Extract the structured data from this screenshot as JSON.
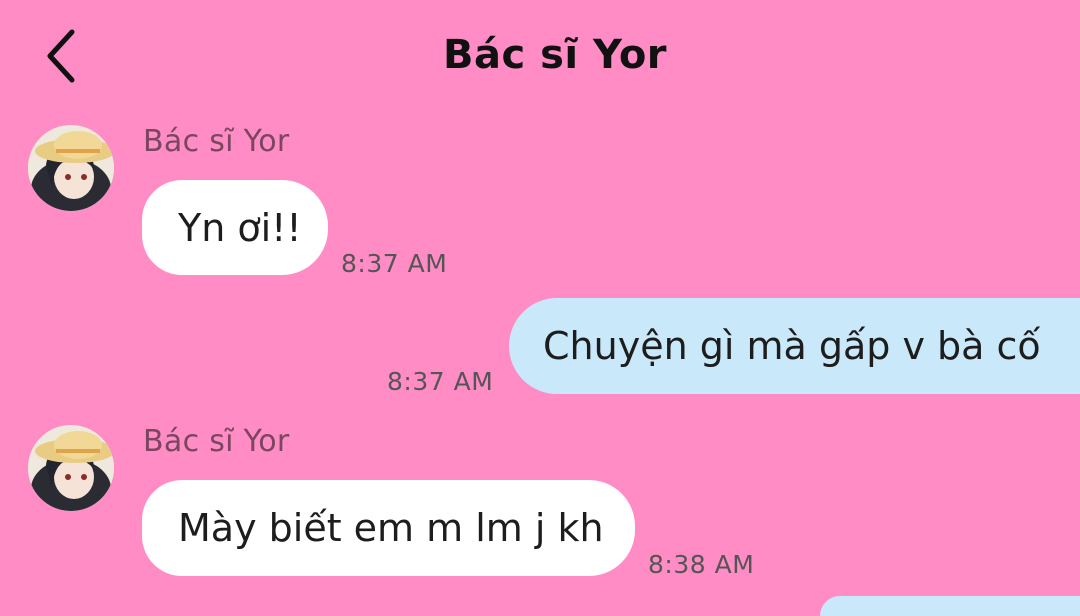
{
  "header": {
    "title": "Bác sĩ Yor",
    "back_icon": "chevron-left-icon"
  },
  "colors": {
    "background": "#ff8cc5",
    "incoming_bubble": "#ffffff",
    "outgoing_bubble": "#c9e9fb"
  },
  "messages": [
    {
      "direction": "incoming",
      "sender": "Bác sĩ Yor",
      "text": "Yn ơi!!",
      "time": "8:37 AM"
    },
    {
      "direction": "outgoing",
      "text": "Chuyện gì mà gấp v bà cố",
      "time": "8:37 AM"
    },
    {
      "direction": "incoming",
      "sender": "Bác sĩ Yor",
      "text": "Mày biết em m lm j kh",
      "time": "8:38 AM"
    }
  ]
}
